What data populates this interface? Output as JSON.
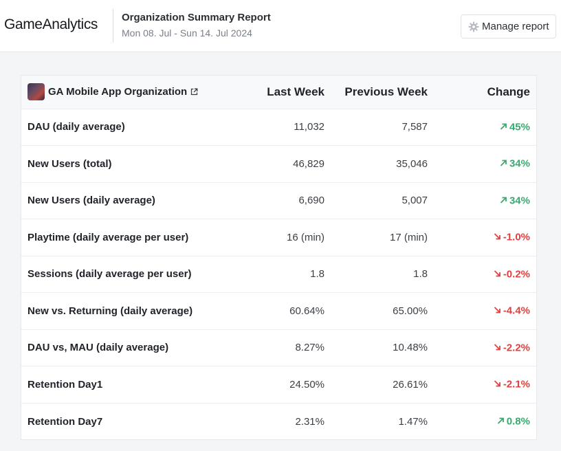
{
  "header": {
    "logo": "GameAnalytics",
    "report_title": "Organization Summary Report",
    "date_range": "Mon 08. Jul - Sun 14. Jul 2024",
    "manage_label": "Manage report"
  },
  "table": {
    "org_name": "GA Mobile App Organization",
    "columns": [
      "Last Week",
      "Previous Week",
      "Change"
    ],
    "rows": [
      {
        "metric": "DAU (daily average)",
        "last": "11,032",
        "prev": "7,587",
        "change": "45%",
        "dir": "up"
      },
      {
        "metric": "New Users (total)",
        "last": "46,829",
        "prev": "35,046",
        "change": "34%",
        "dir": "up"
      },
      {
        "metric": "New Users (daily average)",
        "last": "6,690",
        "prev": "5,007",
        "change": "34%",
        "dir": "up"
      },
      {
        "metric": "Playtime (daily average per user)",
        "last": "16 (min)",
        "prev": "17 (min)",
        "change": "-1.0%",
        "dir": "down"
      },
      {
        "metric": "Sessions (daily average per user)",
        "last": "1.8",
        "prev": "1.8",
        "change": "-0.2%",
        "dir": "down"
      },
      {
        "metric": "New vs. Returning (daily average)",
        "last": "60.64%",
        "prev": "65.00%",
        "change": "-4.4%",
        "dir": "down"
      },
      {
        "metric": "DAU vs, MAU (daily average)",
        "last": "8.27%",
        "prev": "10.48%",
        "change": "-2.2%",
        "dir": "down"
      },
      {
        "metric": "Retention Day1",
        "last": "24.50%",
        "prev": "26.61%",
        "change": "-2.1%",
        "dir": "down"
      },
      {
        "metric": "Retention Day7",
        "last": "2.31%",
        "prev": "1.47%",
        "change": "0.8%",
        "dir": "up"
      }
    ]
  },
  "colors": {
    "positive": "#3aa86f",
    "negative": "#e0403f"
  },
  "icons": {
    "settings": "gear-icon",
    "external_link": "external-link-icon",
    "trend_up": "arrow-up-right-icon",
    "trend_down": "arrow-down-right-icon"
  }
}
